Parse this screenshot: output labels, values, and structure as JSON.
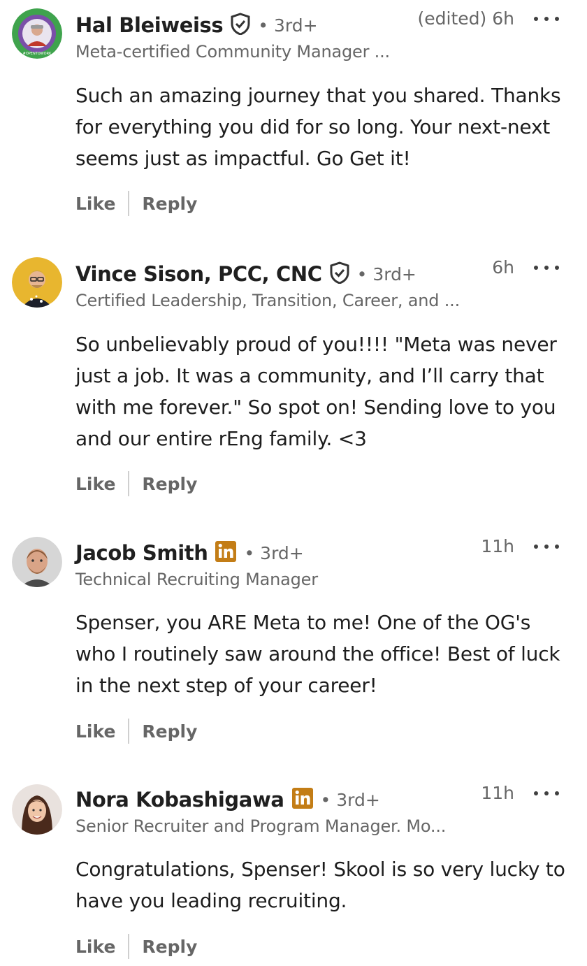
{
  "comments": [
    {
      "name": "Hal Bleiweiss",
      "badge": "verified-shield",
      "degree": "• 3rd+",
      "subtitle": "Meta-certified Community Manager ...",
      "time": "(edited) 6h",
      "text": "Such an amazing journey that you shared. Thanks for everything you did for so long. Your next-next seems just as impactful. Go Get it!",
      "like_label": "Like",
      "reply_label": "Reply"
    },
    {
      "name": "Vince Sison, PCC, CNC",
      "badge": "verified-shield",
      "degree": "• 3rd+",
      "subtitle": "Certified Leadership, Transition, Career, and ...",
      "time": "6h",
      "text": "So unbelievably proud of you!!!! \"Meta was never just a job. It was a community, and I’ll carry that with me forever.\" So spot on! Sending love to you and our entire rEng family. <3",
      "like_label": "Like",
      "reply_label": "Reply"
    },
    {
      "name": "Jacob Smith",
      "badge": "linkedin-premium",
      "degree": "• 3rd+",
      "subtitle": "Technical Recruiting Manager",
      "time": "11h",
      "text": "Spenser, you ARE Meta to me! One of the OG's who I routinely saw around the office! Best of luck in the next step of your career!",
      "like_label": "Like",
      "reply_label": "Reply"
    },
    {
      "name": "Nora Kobashigawa",
      "badge": "linkedin-premium",
      "degree": "• 3rd+",
      "subtitle": "Senior Recruiter and Program Manager. Mo...",
      "time": "11h",
      "text": "Congratulations, Spenser! Skool is so very lucky to have you leading recruiting.",
      "like_label": "Like",
      "reply_label": "Reply"
    }
  ],
  "colors": {
    "text_primary": "#1d1d1d",
    "text_secondary": "#666666",
    "premium_gold": "#c37d16",
    "divider": "#cfcfcf"
  }
}
